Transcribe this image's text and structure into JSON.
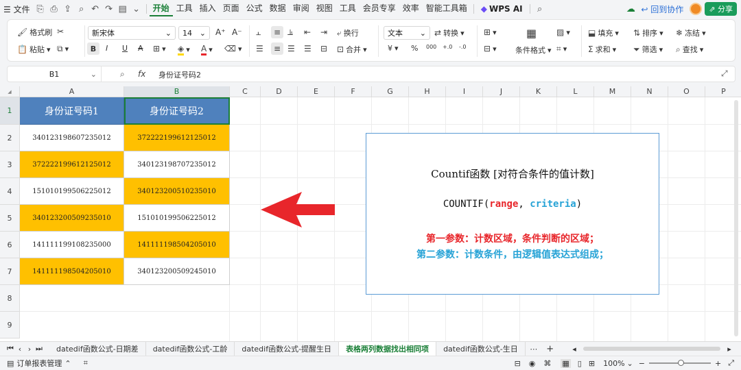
{
  "menubar": {
    "file": "文件",
    "tabs": [
      "开始",
      "工具",
      "插入",
      "页面",
      "公式",
      "数据",
      "审阅",
      "视图",
      "工具",
      "会员专享",
      "效率",
      "智能工具箱"
    ],
    "active_tab": "开始",
    "wps_ai": "WPS AI",
    "back_collab": "回到协作",
    "share": "分享"
  },
  "ribbon": {
    "format_painter": "格式刷",
    "paste": "粘贴",
    "font_name": "新宋体",
    "font_size": "14",
    "bold": "B",
    "italic": "I",
    "underline": "U",
    "strike": "A",
    "wrap": "换行",
    "merge": "合并",
    "number_format": "文本",
    "convert": "转换",
    "currency": "¥",
    "percent": "%",
    "thousands": "000",
    "dec_inc": "+.0",
    "dec_dec": "-.0",
    "cond_format": "条件格式",
    "fill": "填充",
    "sort": "排序",
    "freeze": "冻结",
    "sum": "求和",
    "filter": "筛选",
    "find": "查找"
  },
  "formula_bar": {
    "cell_ref": "B1",
    "fx": "fx",
    "content": "身份证号码2"
  },
  "grid": {
    "columns": [
      "A",
      "B",
      "C",
      "D",
      "E",
      "F",
      "G",
      "H",
      "I",
      "J",
      "K",
      "L",
      "M",
      "N",
      "O",
      "P"
    ],
    "rows": [
      "1",
      "2",
      "3",
      "4",
      "5",
      "6",
      "7",
      "8",
      "9"
    ],
    "header_a": "身份证号码1",
    "header_b": "身份证号码2",
    "col_a": [
      "340123198607235012",
      "372222199612125012",
      "151010199506225012",
      "340123200509235010",
      "141111199108235000",
      "141111198504205010"
    ],
    "col_b": [
      "372222199612125012",
      "340123198707235012",
      "340123200510235010",
      "151010199506225012",
      "141111198504205010",
      "340123200509245010"
    ],
    "col_a_yellow": [
      false,
      true,
      false,
      true,
      false,
      true
    ],
    "col_b_yellow": [
      true,
      false,
      true,
      false,
      true,
      false
    ]
  },
  "infobox": {
    "title": "Countif函数 [对符合条件的值计数]",
    "formula_prefix": "COUNTIF(",
    "formula_arg1": "range",
    "formula_sep": ", ",
    "formula_arg2": "criteria",
    "formula_suffix": ")",
    "param1": "第一参数：计数区域，条件判断的区域；",
    "param2": "第二参数：计数条件，由逻辑值表达式组成；",
    "arg_color": "#e8262b",
    "arg2_color": "#27a3d6"
  },
  "sheet_tabs": {
    "tabs": [
      "datedif函数公式-日期差",
      "datedif函数公式-工龄",
      "datedif函数公式-提醒生日",
      "表格两列数据找出相同项",
      "datedif函数公式-生日"
    ],
    "active": "表格两列数据找出相同项",
    "more": "⋯",
    "add": "+"
  },
  "statusbar": {
    "doc_manage": "订单报表管理",
    "zoom": "100%"
  },
  "colors": {
    "header_blue": "#4f81bd",
    "highlight_yellow": "#ffc000",
    "accent_green": "#1a7f37",
    "arrow_red": "#e8262b"
  }
}
